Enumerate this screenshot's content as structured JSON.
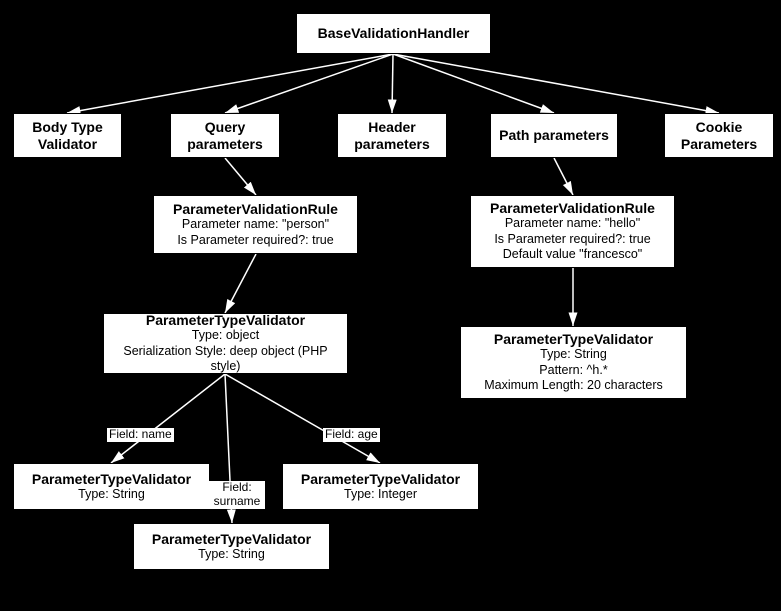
{
  "root": {
    "title": "BaseValidationHandler"
  },
  "row1": {
    "body": {
      "l1": "Body Type",
      "l2": "Validator"
    },
    "query": {
      "l1": "Query",
      "l2": "parameters"
    },
    "header": {
      "l1": "Header",
      "l2": "parameters"
    },
    "path": {
      "l1": "Path parameters"
    },
    "cookie": {
      "l1": "Cookie",
      "l2": "Parameters"
    }
  },
  "rules": {
    "left": {
      "title": "ParameterValidationRule",
      "d1": "Parameter name: \"person\"",
      "d2": "Is Parameter required?: true"
    },
    "right": {
      "title": "ParameterValidationRule",
      "d1": "Parameter name: \"hello\"",
      "d2": "Is Parameter required?: true",
      "d3": "Default value \"francesco\""
    }
  },
  "typeValidators": {
    "left": {
      "title": "ParameterTypeValidator",
      "d1": "Type: object",
      "d2": "Serialization Style: deep object (PHP style)"
    },
    "right": {
      "title": "ParameterTypeValidator",
      "d1": "Type: String",
      "d2": "Pattern: ^h.*",
      "d3": "Maximum Length: 20 characters"
    }
  },
  "children": {
    "name": {
      "title": "ParameterTypeValidator",
      "d1": "Type: String"
    },
    "age": {
      "title": "ParameterTypeValidator",
      "d1": "Type: Integer"
    },
    "surname": {
      "title": "ParameterTypeValidator",
      "d1": "Type: String"
    }
  },
  "edgeLabels": {
    "name": "Field: name",
    "age": "Field: age",
    "surnameL1": "Field:",
    "surnameL2": "surname"
  }
}
